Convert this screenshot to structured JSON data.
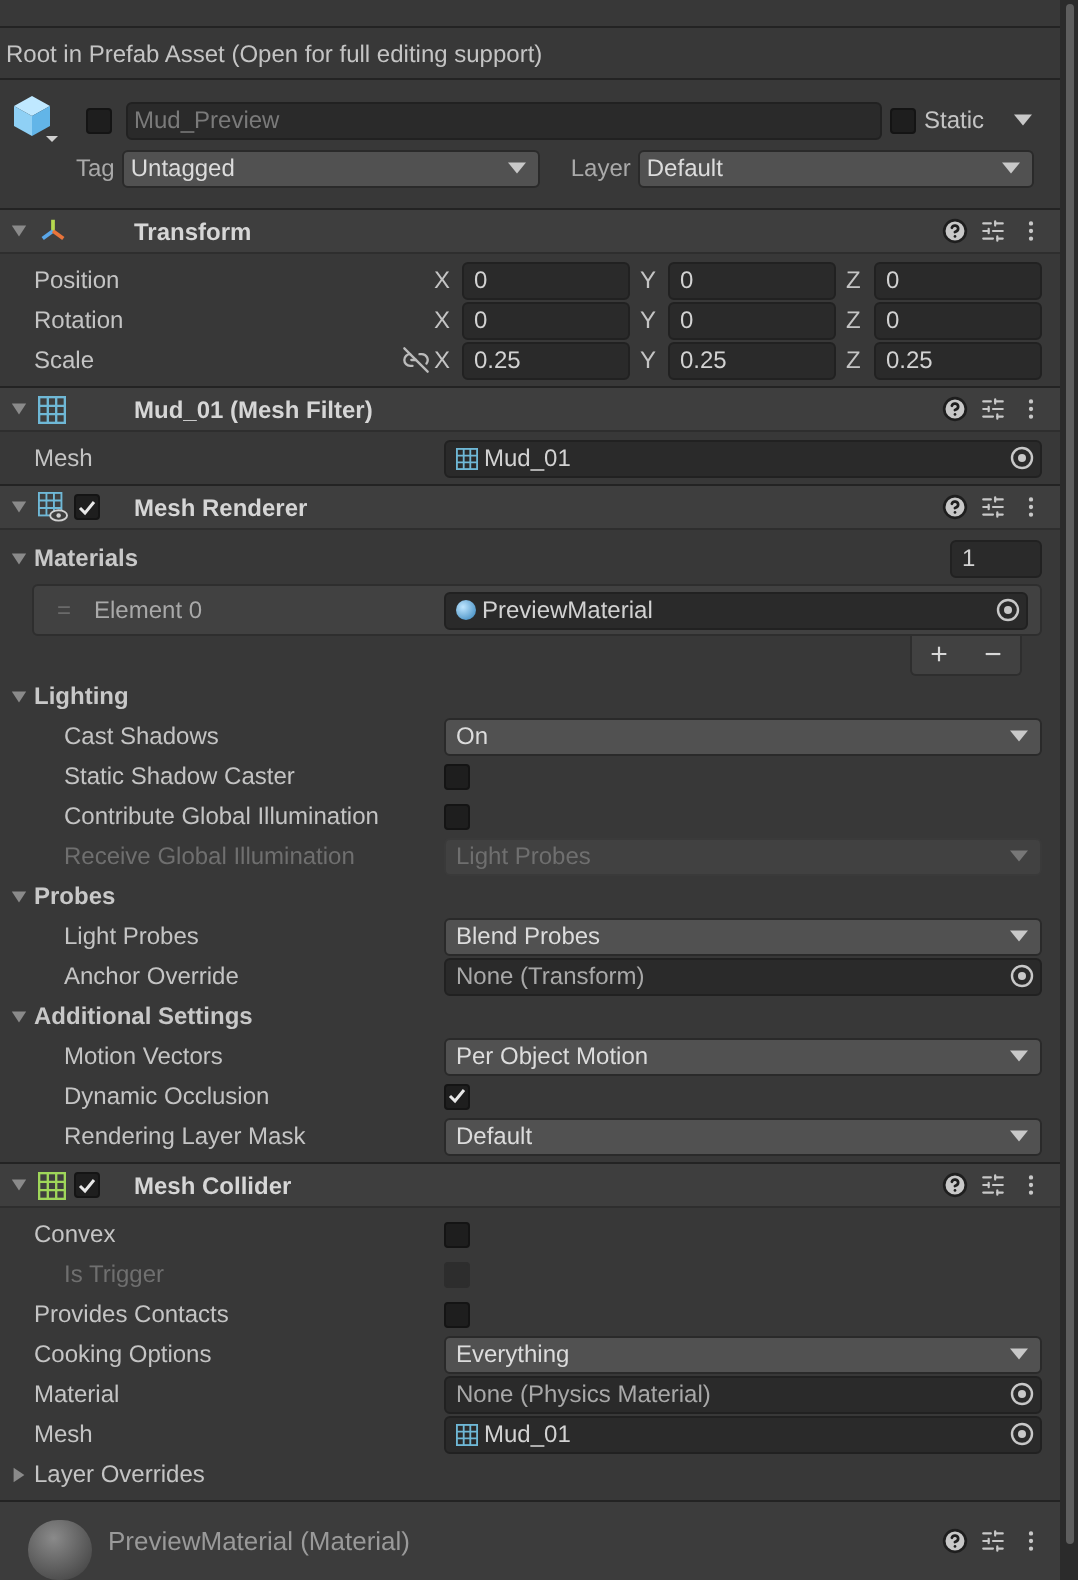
{
  "notice": "Root in Prefab Asset (Open for full editing support)",
  "object": {
    "active": false,
    "name": "Mud_Preview",
    "static": false,
    "static_label": "Static",
    "tag_label": "Tag",
    "tag": "Untagged",
    "layer_label": "Layer",
    "layer": "Default"
  },
  "components": [
    {
      "kind": "transform",
      "title": "Transform",
      "expanded": true,
      "rows": [
        {
          "kind": "vector3",
          "label": "Position",
          "axes": [
            {
              "axis": "X",
              "value": "0"
            },
            {
              "axis": "Y",
              "value": "0"
            },
            {
              "axis": "Z",
              "value": "0"
            }
          ]
        },
        {
          "kind": "vector3",
          "label": "Rotation",
          "axes": [
            {
              "axis": "X",
              "value": "0"
            },
            {
              "axis": "Y",
              "value": "0"
            },
            {
              "axis": "Z",
              "value": "0"
            }
          ]
        },
        {
          "kind": "vector3",
          "label": "Scale",
          "constrained": false,
          "axes": [
            {
              "axis": "X",
              "value": "0.25"
            },
            {
              "axis": "Y",
              "value": "0.25"
            },
            {
              "axis": "Z",
              "value": "0.25"
            }
          ]
        }
      ]
    },
    {
      "kind": "mesh_filter",
      "title": "Mud_01 (Mesh Filter)",
      "expanded": true,
      "rows": [
        {
          "kind": "mesh_ref",
          "label": "Mesh",
          "value": "Mud_01"
        }
      ]
    },
    {
      "kind": "mesh_renderer",
      "title": "Mesh Renderer",
      "enabled": true,
      "expanded": true,
      "rows": [
        {
          "kind": "array",
          "label": "Materials",
          "expanded": true,
          "count": "1",
          "add": "+",
          "remove": "−",
          "elements": [
            {
              "kind": "material_ref",
              "label": "Element 0",
              "handle": "=",
              "value": "PreviewMaterial"
            }
          ]
        },
        {
          "kind": "group",
          "label": "Lighting",
          "expanded": true,
          "children": [
            {
              "kind": "dropdown",
              "label": "Cast Shadows",
              "value": "On",
              "disabled": false
            },
            {
              "kind": "checkbox",
              "label": "Static Shadow Caster",
              "checked": false,
              "disabled": false
            },
            {
              "kind": "checkbox",
              "label": "Contribute Global Illumination",
              "checked": false,
              "disabled": false
            },
            {
              "kind": "dropdown",
              "label": "Receive Global Illumination",
              "value": "Light Probes",
              "disabled": true
            }
          ]
        },
        {
          "kind": "group",
          "label": "Probes",
          "expanded": true,
          "children": [
            {
              "kind": "dropdown",
              "label": "Light Probes",
              "value": "Blend Probes",
              "disabled": false
            },
            {
              "kind": "empty_ref",
              "label": "Anchor Override",
              "value": "None (Transform)"
            }
          ]
        },
        {
          "kind": "group",
          "label": "Additional Settings",
          "expanded": true,
          "children": [
            {
              "kind": "dropdown",
              "label": "Motion Vectors",
              "value": "Per Object Motion",
              "disabled": false
            },
            {
              "kind": "checkbox",
              "label": "Dynamic Occlusion",
              "checked": true,
              "disabled": false
            },
            {
              "kind": "dropdown",
              "label": "Rendering Layer Mask",
              "value": "Default",
              "disabled": false
            }
          ]
        }
      ]
    },
    {
      "kind": "mesh_collider",
      "title": "Mesh Collider",
      "enabled": true,
      "expanded": true,
      "rows": [
        {
          "kind": "checkbox",
          "label": "Convex",
          "checked": false,
          "disabled": false,
          "children": [
            {
              "kind": "checkbox",
              "label": "Is Trigger",
              "checked": false,
              "disabled": true
            }
          ]
        },
        {
          "kind": "checkbox",
          "label": "Provides Contacts",
          "checked": false,
          "disabled": false
        },
        {
          "kind": "dropdown",
          "label": "Cooking Options",
          "value": "Everything",
          "disabled": false
        },
        {
          "kind": "empty_ref",
          "label": "Material",
          "value": "None (Physics Material)"
        },
        {
          "kind": "mesh_ref",
          "label": "Mesh",
          "value": "Mud_01"
        },
        {
          "kind": "foldout",
          "label": "Layer Overrides",
          "expanded": false
        }
      ]
    }
  ],
  "footer": {
    "title": "PreviewMaterial (Material)"
  }
}
